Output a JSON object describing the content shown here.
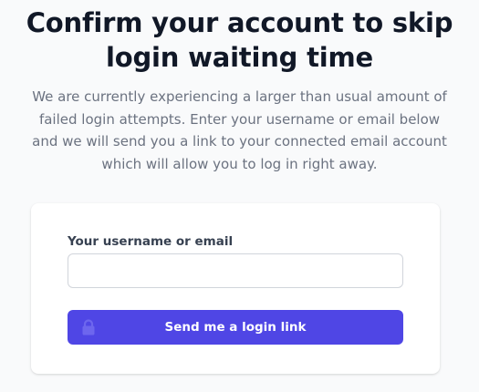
{
  "page": {
    "heading_line1": "Confirm your account to skip",
    "heading_line2": "login waiting time",
    "description_lines": [
      "We are currently experiencing a larger than usual amount of",
      "failed login attempts. Enter your username or email below",
      "and we will send you a link to your connected email account",
      "which will allow you to log in right away."
    ]
  },
  "form": {
    "username_label": "Your username or email",
    "username_value": "",
    "submit_label": "Send me a login link",
    "submit_icon": "lock-icon"
  },
  "colors": {
    "accent": "#4f46e5",
    "heading": "#111827",
    "muted_text": "#6b7280",
    "background": "#f9fafb"
  }
}
